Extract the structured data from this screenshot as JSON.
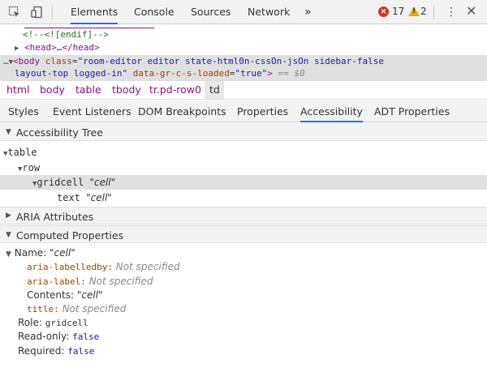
{
  "toolbar": {
    "tabs": [
      "Elements",
      "Console",
      "Sources",
      "Network"
    ],
    "more_label": "»",
    "error_count": "17",
    "warning_count": "2",
    "icons": [
      "inspect-icon",
      "device-toggle-icon"
    ]
  },
  "dom": {
    "comment_line": "<!--<![endif]-->",
    "head_line_tag": "<head>",
    "head_line_ellipsis": "…",
    "head_line_close": "</head>",
    "body_open": "<body ",
    "body_attr1_name": "class",
    "body_attr1_val": "\"room-editor editor state-html0n-cssOn-jsOn sidebar-false",
    "body_attr1_val2": "layout-top  logged-in\"",
    "body_attr2_name": "data-gr-c-s-loaded",
    "body_attr2_val": "\"true\"",
    "body_close": ">",
    "body_suffix": " == $0"
  },
  "breadcrumbs": [
    "html",
    "body",
    "table",
    "tbody",
    "tr.pd-row0",
    "td"
  ],
  "panel_tabs": [
    "Styles",
    "Event Listeners",
    "DOM Breakpoints",
    "Properties",
    "Accessibility",
    "ADT Properties"
  ],
  "active_panel_tab": "Accessibility",
  "accessibility_tree": {
    "title": "Accessibility Tree",
    "nodes": [
      {
        "role": "table",
        "name": ""
      },
      {
        "role": "row",
        "name": ""
      },
      {
        "role": "gridcell",
        "name": "\"cell\""
      },
      {
        "role": "text",
        "name": "\"cell\""
      }
    ]
  },
  "aria_attributes": {
    "title": "ARIA Attributes"
  },
  "computed_properties": {
    "title": "Computed Properties",
    "name_label": "Name:",
    "name_value": "\"cell\"",
    "sources": [
      {
        "key": "aria-labelledby",
        "sep": ":",
        "value": "Not specified"
      },
      {
        "key": "aria-label",
        "sep": ":",
        "value": "Not specified"
      }
    ],
    "contents_label": "Contents:",
    "contents_value": "\"cell\"",
    "title_key": "title",
    "title_value": "Not specified",
    "role_label": "Role:",
    "role_value": "gridcell",
    "readonly_label": "Read-only:",
    "readonly_value": "false",
    "required_label": "Required:",
    "required_value": "false"
  },
  "colors": {
    "accent": "#1a73e8",
    "tag": "#881280",
    "attr_name": "#994500",
    "attr_value": "#1a1aa6",
    "comment": "#236e25",
    "error": "#d93025",
    "warning": "#f2a600"
  }
}
